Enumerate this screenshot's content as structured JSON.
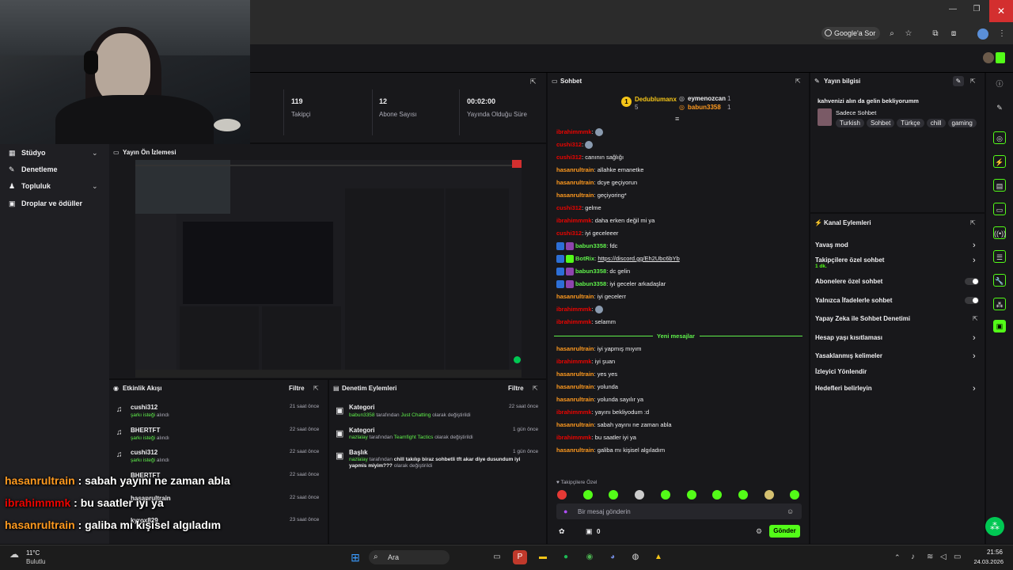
{
  "browser": {
    "google_sor": "Google'a Sor"
  },
  "stats": [
    {
      "value": "119",
      "label": "Takipçi"
    },
    {
      "value": "12",
      "label": "Abone Sayısı"
    },
    {
      "value": "00:02:00",
      "label": "Yayında Olduğu Süre"
    }
  ],
  "leftnav": {
    "items": [
      {
        "label": "Stüdyo"
      },
      {
        "label": "Denetleme"
      },
      {
        "label": "Topluluk"
      },
      {
        "label": "Droplar ve ödüller"
      }
    ]
  },
  "preview": {
    "title": "Yayın Ön İzlemesi"
  },
  "activity": {
    "title": "Etkinlik Akışı",
    "filter": "Filtre",
    "items": [
      {
        "user": "cushi312",
        "action": "şarkı isteği",
        "action_suffix": "alındı",
        "time": "21 saat önce"
      },
      {
        "user": "BHERTFT",
        "action": "şarkı isteği",
        "action_suffix": "alındı",
        "time": "22 saat önce"
      },
      {
        "user": "cushi312",
        "action": "şarkı isteği",
        "action_suffix": "alındı",
        "time": "22 saat önce"
      },
      {
        "user": "BHERTFT",
        "time": "22 saat önce"
      },
      {
        "user": "hasanrultrain",
        "time": "22 saat önce"
      },
      {
        "user": "kyrox829",
        "time": "23 saat önce"
      }
    ]
  },
  "moderation": {
    "title": "Denetim Eylemleri",
    "filter": "Filtre",
    "items": [
      {
        "title": "Kategori",
        "actor": "babun3358",
        "mid": "tarafından",
        "target": "Just Chatting",
        "end": "olarak değiştirildi",
        "time": "22 saat önce"
      },
      {
        "title": "Kategori",
        "actor": "nazlalay",
        "mid": "tarafından",
        "target": "Teamfight Tactics",
        "end": "olarak değiştirildi",
        "time": "1 gün önce"
      },
      {
        "title": "Başlık",
        "actor": "nazlalay",
        "mid": "tarafından",
        "target": "chill takılıp biraz sohbetli tft akar diye dusundum iyi yapmis miyim???",
        "end": "olarak değiştirildi",
        "time": "1 gün önce"
      }
    ]
  },
  "chat": {
    "title": "Sohbet",
    "leaders": [
      {
        "name": "Dedublumanx",
        "count": "5"
      },
      {
        "name": "eymenozcan",
        "count": "1"
      },
      {
        "name": "babun3358",
        "count": "1"
      }
    ],
    "messages_old": [
      {
        "user": "ibrahimmmk",
        "text": "",
        "color": "#eb0400"
      },
      {
        "user": "cushi312",
        "text": "",
        "color": "#eb0400"
      },
      {
        "user": "cushi312",
        "text": "canının sağlığı",
        "color": "#eb0400"
      },
      {
        "user": "hasanrultrain",
        "text": "allahke emanetke",
        "color": "#ff9a1f"
      },
      {
        "user": "hasanrultrain",
        "text": "dcye geçiyorun",
        "color": "#ff9a1f"
      },
      {
        "user": "hasanrultrain",
        "text": "geçiyoring*",
        "color": "#ff9a1f"
      },
      {
        "user": "cushi312",
        "text": "gelme",
        "color": "#eb0400"
      },
      {
        "user": "ibrahimmmk",
        "text": "daha erken değil mi ya",
        "color": "#eb0400"
      },
      {
        "user": "cushi312",
        "text": "iyi geceleeer",
        "color": "#eb0400"
      },
      {
        "user": "babun3358",
        "text": "fdc",
        "color": "#5ff04b"
      },
      {
        "user": "BotRix",
        "text": "https://discord.gg/Eh2Ubc6bYb",
        "color": "#5ff04b"
      },
      {
        "user": "babun3358",
        "text": "dc gelin",
        "color": "#5ff04b"
      },
      {
        "user": "babun3358",
        "text": "iyi geceler arkadaşlar",
        "color": "#5ff04b"
      },
      {
        "user": "hasanrultrain",
        "text": "iyi gecelerr",
        "color": "#ff9a1f"
      },
      {
        "user": "ibrahimmmk",
        "text": "",
        "color": "#eb0400"
      },
      {
        "user": "ibrahimmmk",
        "text": "selamm",
        "color": "#eb0400"
      }
    ],
    "new_label": "Yeni mesajlar",
    "messages_new": [
      {
        "user": "hasanrultrain",
        "text": "iyi yapmış mıyım",
        "color": "#ff9a1f"
      },
      {
        "user": "ibrahimmmk",
        "text": "iyi şuan",
        "color": "#eb0400"
      },
      {
        "user": "hasanrultrain",
        "text": "yes yes",
        "color": "#ff9a1f"
      },
      {
        "user": "hasanrultrain",
        "text": "yolunda",
        "color": "#ff9a1f"
      },
      {
        "user": "hasanrultrain",
        "text": "yolunda sayılır ya",
        "color": "#ff9a1f"
      },
      {
        "user": "ibrahimmmk",
        "text": "yayını bekliyodum :d",
        "color": "#eb0400"
      },
      {
        "user": "hasanrultrain",
        "text": "sabah yayını ne zaman abla",
        "color": "#ff9a1f"
      },
      {
        "user": "ibrahimmmk",
        "text": "bu saatler iyi ya",
        "color": "#eb0400"
      },
      {
        "user": "hasanrultrain",
        "text": "galiba mı kişisel algıladım",
        "color": "#ff9a1f"
      }
    ],
    "followers_only": "Takipçilere Özel",
    "placeholder": "Bir mesaj gönderin",
    "points": "0",
    "send": "Gönder"
  },
  "info": {
    "title": "Yayın bilgisi",
    "stream_title": "kahvenizi alın da gelin bekliyorumm",
    "category": "Sadece Sohbet",
    "tags": [
      "Turkish",
      "Sohbet",
      "Türkçe",
      "chill",
      "gaming"
    ]
  },
  "actions": {
    "title": "Kanal Eylemleri",
    "items": [
      {
        "label": "Yavaş mod",
        "kind": "chevron"
      },
      {
        "label": "Takipçilere özel sohbet",
        "sub": "1 dk.",
        "kind": "chevron"
      },
      {
        "label": "Abonelere özel sohbet",
        "kind": "toggle"
      },
      {
        "label": "Yalnızca İfadelerle sohbet",
        "kind": "toggle"
      },
      {
        "label": "Yapay Zeka ile Sohbet Denetimi",
        "kind": "external"
      },
      {
        "label": "Hesap yaşı kısıtlaması",
        "kind": "chevron"
      },
      {
        "label": "Yasaklanmış kelimeler",
        "kind": "chevron"
      },
      {
        "label": "İzleyici Yönlendir",
        "kind": "none"
      },
      {
        "label": "Hedefleri belirleyin",
        "kind": "chevron"
      }
    ]
  },
  "overlay": [
    {
      "user": "hasanrultrain",
      "text": " : sabah yayını ne zaman abla",
      "color": "#ff9a1f"
    },
    {
      "user": "ibrahimmmk",
      "text": " : bu saatler iyi ya",
      "color": "#eb0400"
    },
    {
      "user": "hasanrultrain",
      "text": " : galiba mı kişisel algıladım",
      "color": "#ff9a1f"
    }
  ],
  "taskbar": {
    "weather_temp": "11°C",
    "weather_desc": "Bulutlu",
    "search": "Ara",
    "time": "21:56",
    "date": "24.03.2026"
  }
}
